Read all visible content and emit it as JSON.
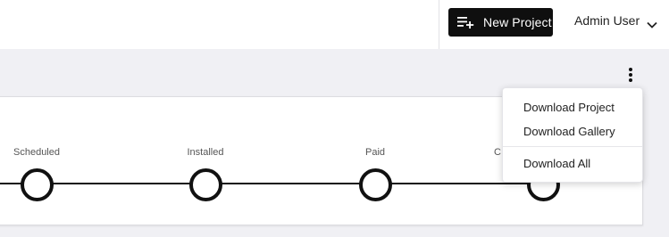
{
  "header": {
    "new_project_label": "New Project",
    "new_project_icon": "playlist-add-icon",
    "user_name": "Admin User",
    "user_menu_icon": "chevron-down-icon"
  },
  "project_card": {
    "menu_icon": "more-vertical-icon",
    "stages": [
      {
        "label": "Scheduled"
      },
      {
        "label": "Installed"
      },
      {
        "label": "Paid"
      },
      {
        "label": "C"
      }
    ]
  },
  "dropdown_menu": {
    "items": [
      {
        "label": "Download Project"
      },
      {
        "label": "Download Gallery"
      },
      {
        "label": "Download All"
      }
    ]
  },
  "colors": {
    "primary_button": "#0f0f0f",
    "background": "#f0f0f4",
    "timeline": "#111111"
  }
}
